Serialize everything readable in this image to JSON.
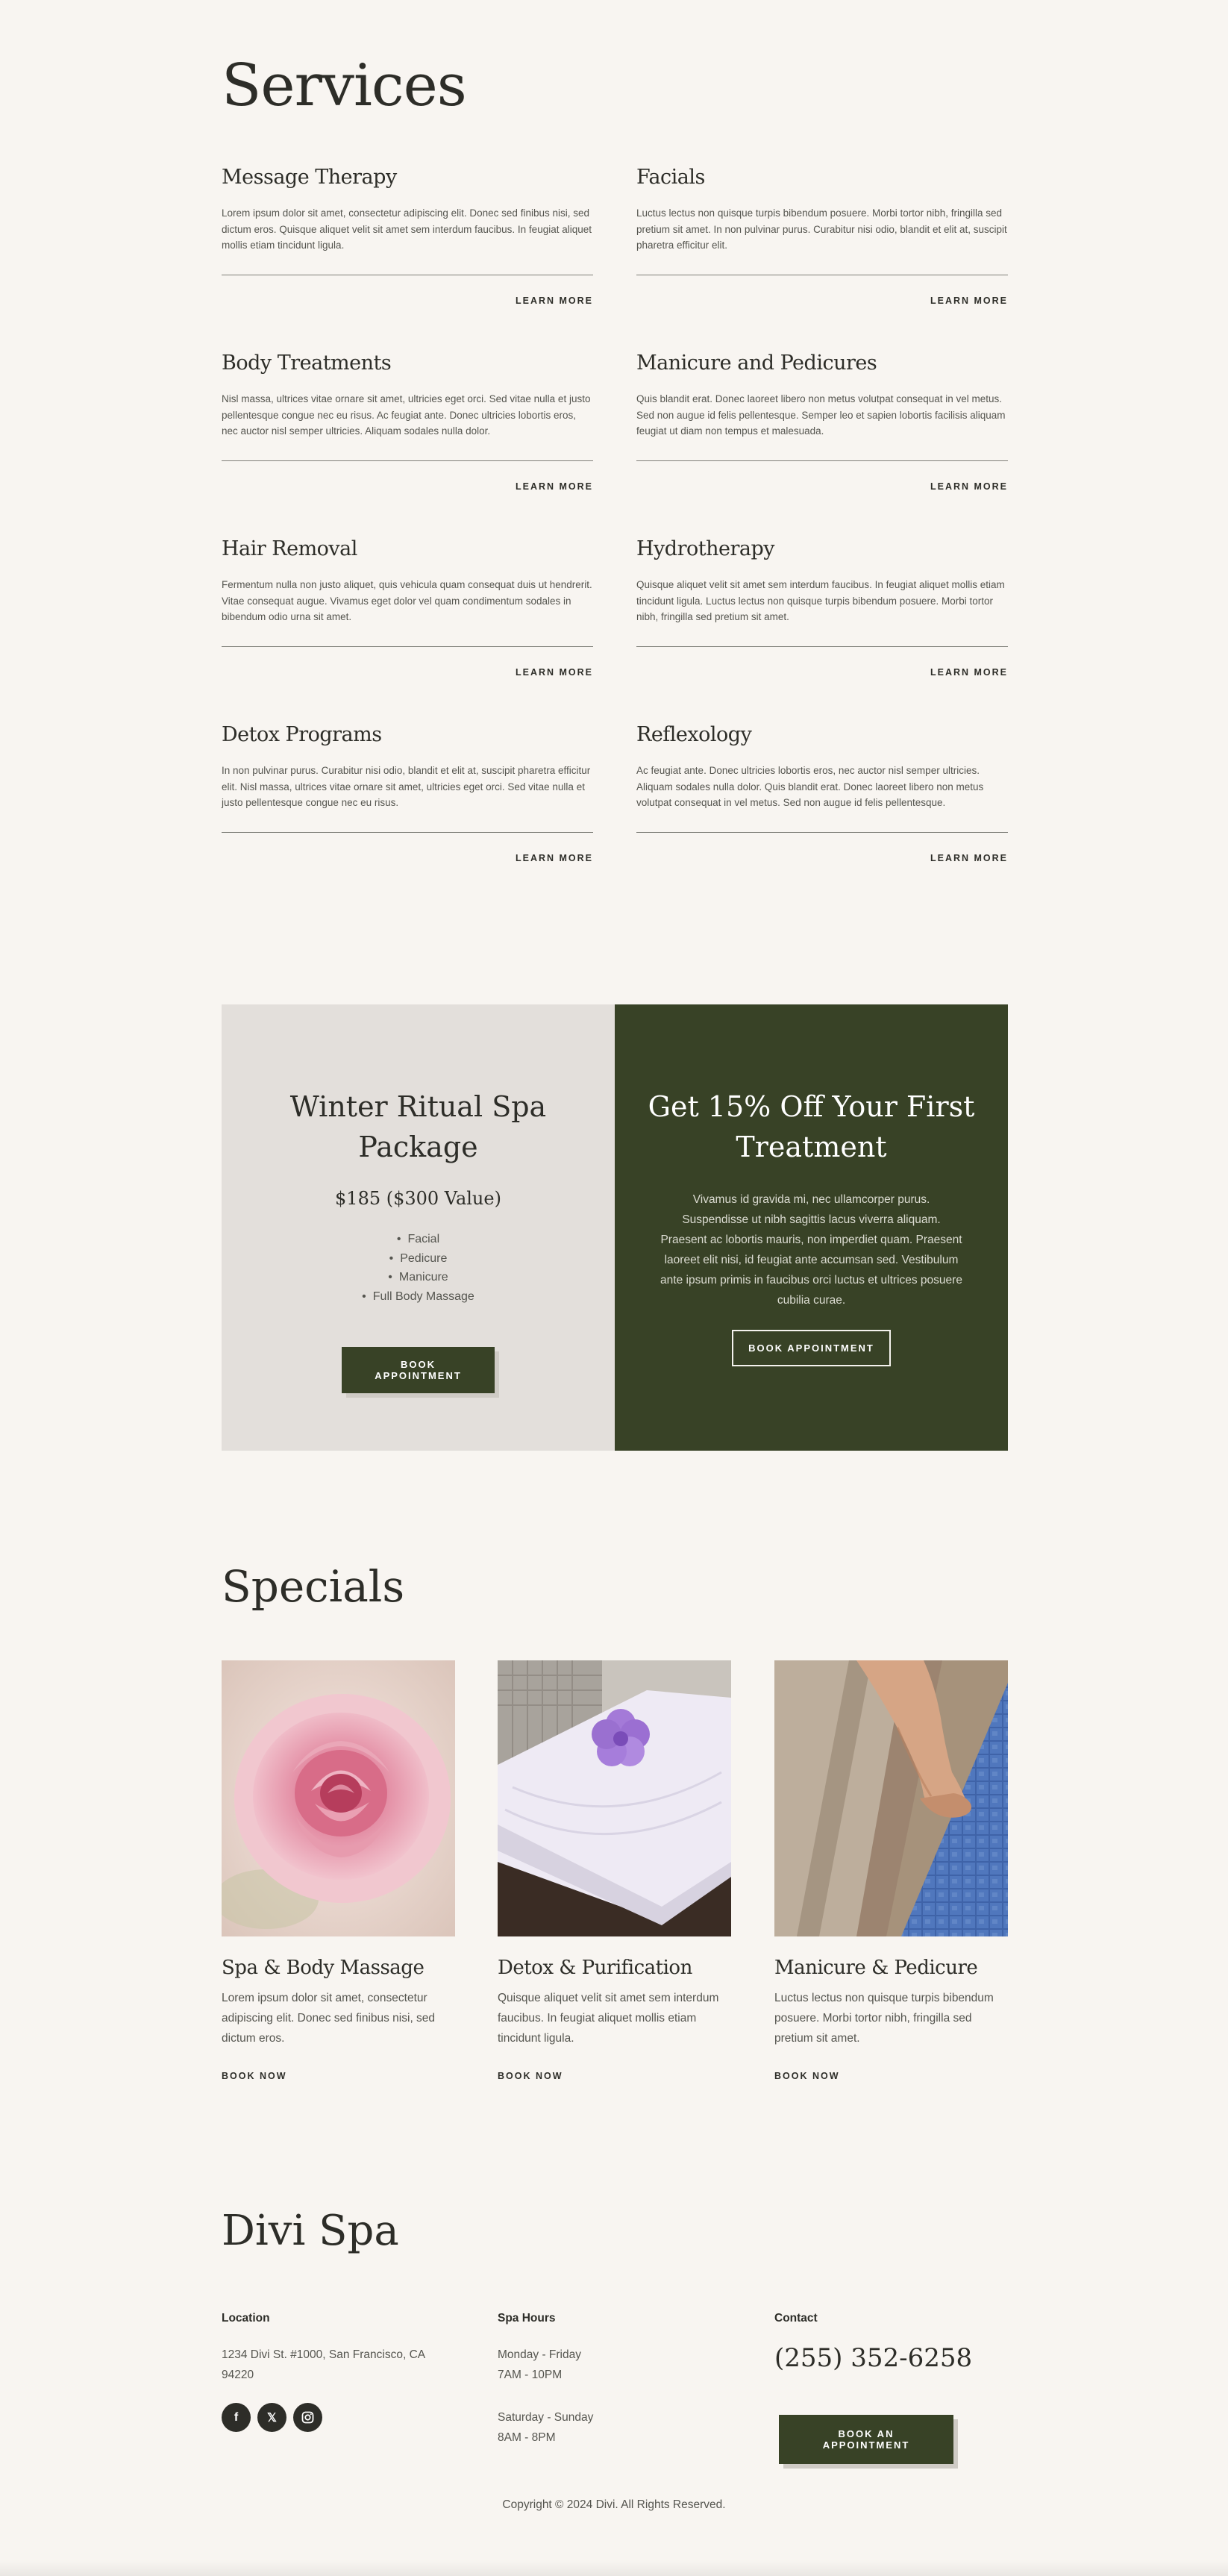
{
  "services": {
    "title": "Services",
    "learn_more": "LEARN MORE",
    "items": [
      {
        "title": "Message Therapy",
        "desc": "Lorem ipsum dolor sit amet, consectetur adipiscing elit. Donec sed finibus nisi, sed dictum eros. Quisque aliquet velit sit amet sem interdum faucibus. In feugiat aliquet mollis etiam tincidunt ligula."
      },
      {
        "title": "Facials",
        "desc": "Luctus lectus non quisque turpis bibendum posuere. Morbi tortor nibh, fringilla sed pretium sit amet. In non pulvinar purus. Curabitur nisi odio, blandit et elit at, suscipit pharetra efficitur elit."
      },
      {
        "title": "Body Treatments",
        "desc": "Nisl massa, ultrices vitae ornare sit amet, ultricies eget orci. Sed vitae nulla et justo pellentesque congue nec eu risus. Ac feugiat ante. Donec ultricies lobortis eros, nec auctor nisl semper ultricies. Aliquam sodales nulla dolor."
      },
      {
        "title": "Manicure and Pedicures",
        "desc": "Quis blandit erat. Donec laoreet libero non metus volutpat consequat in vel metus. Sed non augue id felis pellentesque. Semper leo et sapien lobortis facilisis aliquam feugiat ut diam non tempus et malesuada."
      },
      {
        "title": "Hair Removal",
        "desc": "Fermentum nulla non justo aliquet, quis vehicula quam consequat duis ut hendrerit. Vitae consequat augue. Vivamus eget dolor vel quam condimentum sodales in bibendum odio urna sit amet."
      },
      {
        "title": "Hydrotherapy",
        "desc": "Quisque aliquet velit sit amet sem interdum faucibus. In feugiat aliquet mollis etiam tincidunt ligula. Luctus lectus non quisque turpis bibendum posuere. Morbi tortor nibh, fringilla sed pretium sit amet."
      },
      {
        "title": "Detox Programs",
        "desc": "In non pulvinar purus. Curabitur nisi odio, blandit et elit at, suscipit pharetra efficitur elit. Nisl massa, ultrices vitae ornare sit amet, ultricies eget orci. Sed vitae nulla et justo pellentesque congue nec eu risus."
      },
      {
        "title": "Reflexology",
        "desc": "Ac feugiat ante. Donec ultricies lobortis eros, nec auctor nisl semper ultricies. Aliquam sodales nulla dolor. Quis blandit erat. Donec laoreet libero non metus volutpat consequat in vel metus. Sed non augue id felis pellentesque."
      }
    ]
  },
  "promo": {
    "left": {
      "title": "Winter Ritual Spa Package",
      "price": "$185 ($300 Value)",
      "items": [
        "Facial",
        "Pedicure",
        "Manicure",
        "Full Body Massage"
      ],
      "button": "BOOK APPOINTMENT"
    },
    "right": {
      "title": "Get 15% Off Your First Treatment",
      "text": "Vivamus id gravida mi, nec ullamcorper purus. Suspendisse ut nibh sagittis lacus viverra aliquam. Praesent ac lobortis mauris, non imperdiet quam. Praesent laoreet elit nisi, id feugiat ante accumsan sed. Vestibulum ante ipsum primis in faucibus orci luctus et ultrices posuere cubilia curae.",
      "button": "BOOK APPOINTMENT"
    }
  },
  "specials": {
    "title": "Specials",
    "book_now": "BOOK NOW",
    "cards": [
      {
        "title": "Spa & Body Massage",
        "desc": "Lorem ipsum dolor sit amet, consectetur adipiscing elit. Donec sed finibus nisi, sed dictum eros.",
        "image": "pink-rose-photo"
      },
      {
        "title": "Detox & Purification",
        "desc": "Quisque aliquet velit sit amet sem interdum faucibus. In feugiat aliquet mollis etiam tincidunt ligula.",
        "image": "folded-towel-with-flower-photo"
      },
      {
        "title": "Manicure & Pedicure",
        "desc": "Luctus lectus non quisque turpis bibendum posuere. Morbi tortor nibh, fringilla sed pretium sit amet.",
        "image": "feet-at-pool-edge-photo"
      }
    ]
  },
  "footer": {
    "brand": "Divi Spa",
    "location_label": "Location",
    "address_line1": "1234 Divi St. #1000, San Francisco, CA",
    "address_line2": "94220",
    "hours_label": "Spa Hours",
    "weekday_days": "Monday - Friday",
    "weekday_hours": "7AM - 10PM",
    "weekend_days": "Saturday - Sunday",
    "weekend_hours": "8AM - 8PM",
    "contact_label": "Contact",
    "phone": "(255) 352-6258",
    "button": "BOOK AN APPOINTMENT",
    "social": [
      "facebook-icon",
      "x-icon",
      "instagram-icon"
    ],
    "copyright": "Copyright © 2024 Divi. All Rights Reserved."
  },
  "colors": {
    "background": "#f8f5f1",
    "accent_dark_green": "#384226",
    "panel_beige": "#e3dfdb",
    "text_dark": "#2d2d28"
  }
}
